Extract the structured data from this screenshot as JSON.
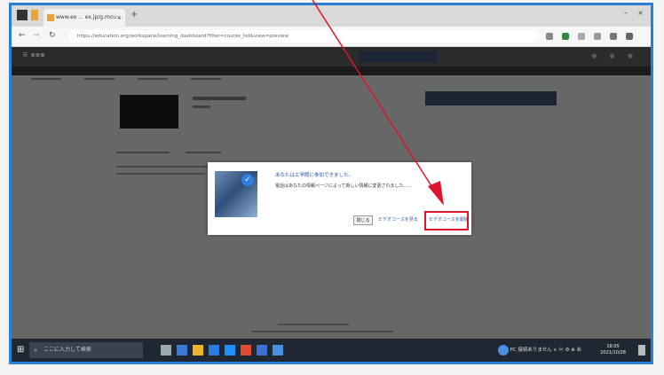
{
  "browser": {
    "tab_title": "www.ex ... ex.jp/g.mcu ...",
    "new_tab": "+",
    "tab_close": "×",
    "url": "https://education.org/workspace/learning_dashboard?filter=course_list&view=preview",
    "window_controls": [
      "–",
      "×"
    ]
  },
  "dialog": {
    "title": "あなたはエ学館に参加できました。",
    "message": "電話はあなたの情報ページによって新しい情報に変更されました......",
    "close_button": "閉じる",
    "secondary_link": "ビデオコースを見る",
    "primary_link": "ビデオコースを開始"
  },
  "taskbar": {
    "start_glyph": "⊞",
    "search_placeholder": "ここに入力して検索",
    "tray_text": "PC 接続ありません  ∧ ⓦ ⚙ ⊕ あ",
    "clock_time": "18:05",
    "clock_date": "2021/10/28"
  },
  "colors": {
    "highlight_border": "#e0142c",
    "annotation_arrow": "#e0142c",
    "screenshot_frame": "#2a7fd6",
    "link": "#2a55a8"
  },
  "icons": [
    "back-arrow-icon",
    "forward-arrow-icon",
    "reload-icon",
    "checkmark-icon",
    "search-icon",
    "windows-start-icon",
    "red-arrow-annotation"
  ]
}
